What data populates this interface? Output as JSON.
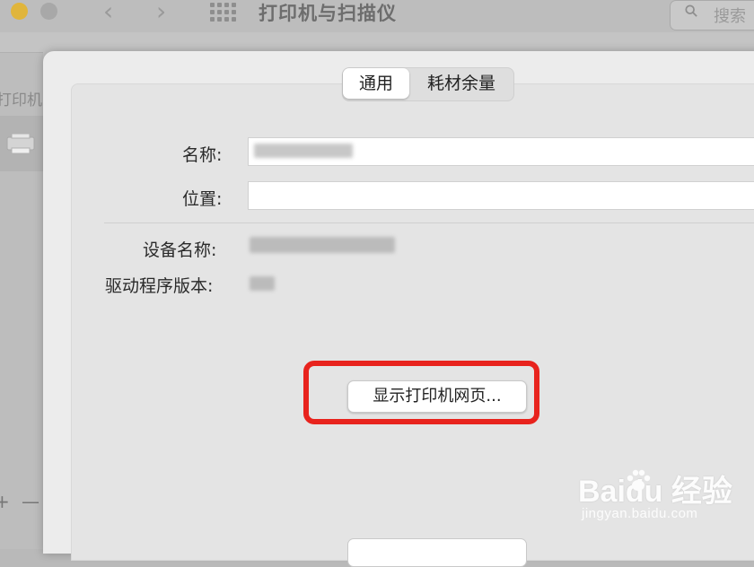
{
  "window": {
    "title": "打印机与扫描仪",
    "search_placeholder": "搜索"
  },
  "sidebar": {
    "header": "打印机",
    "add_button": "+",
    "remove_button": "—"
  },
  "tabs": [
    {
      "label": "通用",
      "active": true
    },
    {
      "label": "耗材余量",
      "active": false
    }
  ],
  "form": {
    "name_label": "名称:",
    "location_label": "位置:",
    "device_name_label": "设备名称:",
    "driver_version_label": "驱动程序版本:"
  },
  "buttons": {
    "show_webpage": "显示打印机网页..."
  },
  "watermark": {
    "logo": "Baidu 经验",
    "site": "jingyan.baidu.com"
  },
  "colors": {
    "highlight": "#e8231d"
  }
}
